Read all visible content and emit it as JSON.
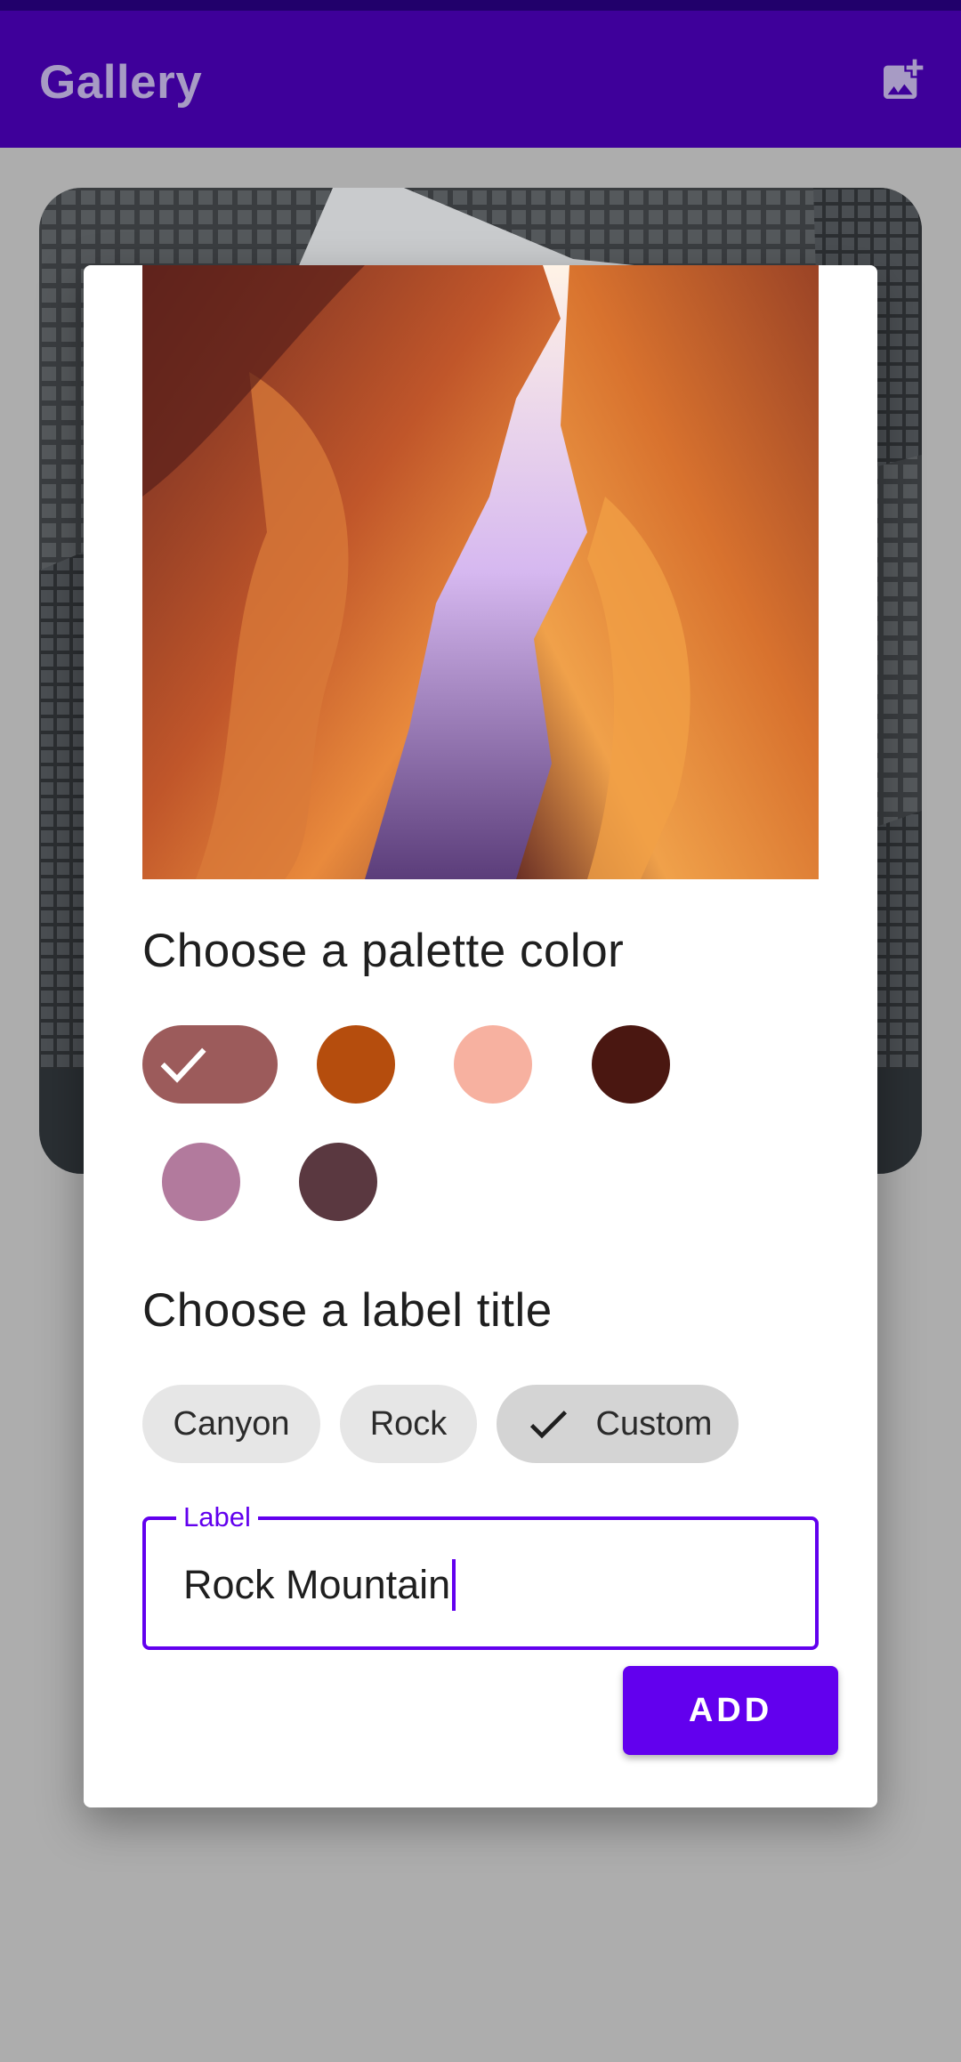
{
  "app_bar": {
    "title": "Gallery",
    "action_icon": "add-photo-icon"
  },
  "dialog": {
    "palette_title": "Choose a palette color",
    "palette": [
      {
        "color": "#9c5b5b",
        "selected": true
      },
      {
        "color": "#b54d0d",
        "selected": false
      },
      {
        "color": "#f7b1a0",
        "selected": false
      },
      {
        "color": "#4a1711",
        "selected": false
      },
      {
        "color": "#b27a9d",
        "selected": false
      },
      {
        "color": "#5a3840",
        "selected": false
      }
    ],
    "label_title": "Choose a label title",
    "chips": [
      {
        "label": "Canyon",
        "selected": false
      },
      {
        "label": "Rock",
        "selected": false
      },
      {
        "label": "Custom",
        "selected": true
      }
    ],
    "field": {
      "label": "Label",
      "value": "Rock Mountain"
    },
    "add_label": "ADD"
  },
  "colors": {
    "app_bar": "#3e009a",
    "accent": "#6200ee",
    "scrim": "#adadad"
  }
}
